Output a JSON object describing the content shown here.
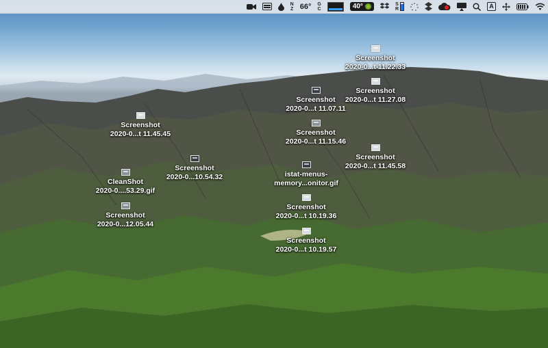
{
  "menubar": {
    "weather_temp": "66°",
    "cpu_temp": "40°",
    "icons": [
      "facetime-icon",
      "bartender-icon",
      "droplet-icon",
      "stat-icon",
      "gpu-icon",
      "graph-icon",
      "temp-pill",
      "dropbox-icon",
      "battery-meter",
      "activity-icon",
      "dropbox-alt-icon",
      "creative-cloud-icon",
      "airplay-icon",
      "search-icon",
      "input-source-icon",
      "move-icon",
      "battery-icon",
      "wifi-icon"
    ],
    "input_source": "A"
  },
  "desktop_icons": [
    {
      "line1": "Screenshot",
      "line2": "2020-0...t 11.22.33"
    },
    {
      "line1": "Screenshot",
      "line2": "2020-0...t 11.27.08"
    },
    {
      "line1": "Screenshot",
      "line2": "2020-0...t 11.07.11"
    },
    {
      "line1": "Screenshot",
      "line2": "2020-0...t 11.45.45"
    },
    {
      "line1": "Screenshot",
      "line2": "2020-0...t 11.15.46"
    },
    {
      "line1": "Screenshot",
      "line2": "2020-0...t 11.45.58"
    },
    {
      "line1": "Screenshot",
      "line2": "2020-0...10.54.32"
    },
    {
      "line1": "CleanShot",
      "line2": "2020-0....53.29.gif"
    },
    {
      "line1": "istat-menus-",
      "line2": "memory...onitor.gif"
    },
    {
      "line1": "Screenshot",
      "line2": "2020-0...12.05.44"
    },
    {
      "line1": "Screenshot",
      "line2": "2020-0...t 10.19.36"
    },
    {
      "line1": "Screenshot",
      "line2": "2020-0...t 10.19.57"
    }
  ]
}
